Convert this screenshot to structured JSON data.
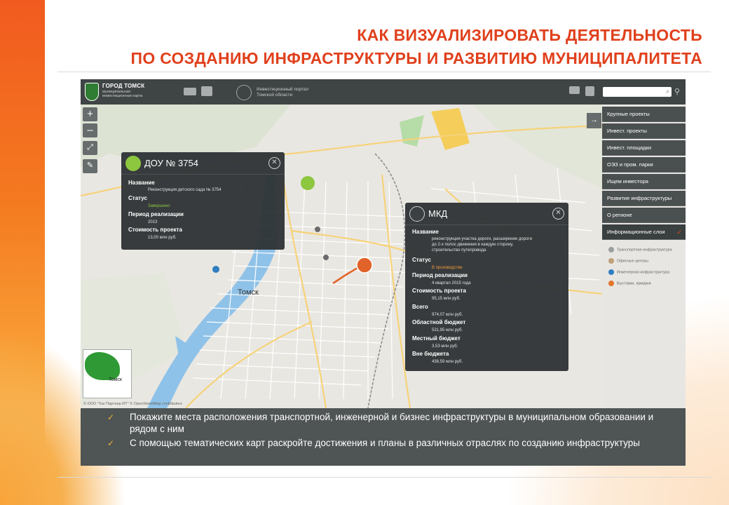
{
  "slide": {
    "title_line1": "КАК ВИЗУАЛИЗИРОВАТЬ ДЕЯТЕЛЬНОСТЬ",
    "title_line2": "ПО СОЗДАНИЮ ИНФРАСТРУКТУРЫ И РАЗВИТИЮ МУНИЦИПАЛИТЕТА",
    "bullets": [
      "Покажите места расположения транспортной, инженерной и бизнес инфраструктуры в муниципальном образовании и рядом с ним",
      "С помощью тематических карт раскройте достижения и планы в различных отраслях по созданию инфраструктуры"
    ]
  },
  "app": {
    "city_name": "ГОРОД ТОМСК",
    "city_subtitle_1": "муниципальная",
    "city_subtitle_2": "инвестиционная карта",
    "portal_line1": "Инвестиционный портал",
    "portal_line2": "Томской области",
    "search_placeholder": "",
    "zoom_in": "+",
    "zoom_out": "–",
    "collapse_arrow": "→",
    "map_city_label": "Томск",
    "minimap_label": "Томск",
    "attribution": "© ООО \"Хаг Партнер ИТ\" © OpenStreetMap contributors"
  },
  "panel": {
    "items": [
      {
        "label": "Крупные проекты"
      },
      {
        "label": "Инвест. проекты"
      },
      {
        "label": "Инвест. площадки"
      },
      {
        "label": "ОЭЗ и пром. парки"
      },
      {
        "label": "Ищем инвестора"
      },
      {
        "label": "Развитие инфраструктуры"
      },
      {
        "label": "О регионе"
      },
      {
        "label": "Информационные слои",
        "checked": true
      }
    ],
    "legend": [
      {
        "label": "Транспортная инфраструктура",
        "color": "#9a9fa0"
      },
      {
        "label": "Офисные центры",
        "color": "#bfa07a"
      },
      {
        "label": "Инженерная инфраструктура",
        "color": "#2f7fc1"
      },
      {
        "label": "Выставки, ярмарки",
        "color": "#e0752b"
      }
    ]
  },
  "popup1": {
    "title": "ДОУ № 3754",
    "name_label": "Название",
    "name_value": "Реконструкция детского сада № 3754",
    "status_label": "Статус",
    "status_value": "Завершено",
    "period_label": "Период реализации",
    "period_value": "2013",
    "cost_label": "Стоимость проекта",
    "cost_value": "13,00 млн руб."
  },
  "popup2": {
    "title": "МКД",
    "name_label": "Название",
    "name_value_1": "реконструкция участка дороги, расширение дороги",
    "name_value_2": "до 2-х полос движения в каждую сторону,",
    "name_value_3": "строительство путепровода",
    "status_label": "Статус",
    "status_value": "В производстве",
    "period_label": "Период реализации",
    "period_value": "4 квартал 2015 года",
    "cost_label": "Стоимость проекта",
    "cost_value": "95,15 млн руб.",
    "total_label": "Всего",
    "total_value": "974,07 млн руб.",
    "regional_label": "Областной бюджет",
    "regional_value": "531,95 млн руб.",
    "local_label": "Местный бюджет",
    "local_value": "3,53 млн руб.",
    "extra_label": "Вне бюджета",
    "extra_value": "438,59 млн руб."
  },
  "colors": {
    "title_red": "#e0401c",
    "green_marker": "#8dc63f",
    "orange_marker": "#e2632a"
  }
}
